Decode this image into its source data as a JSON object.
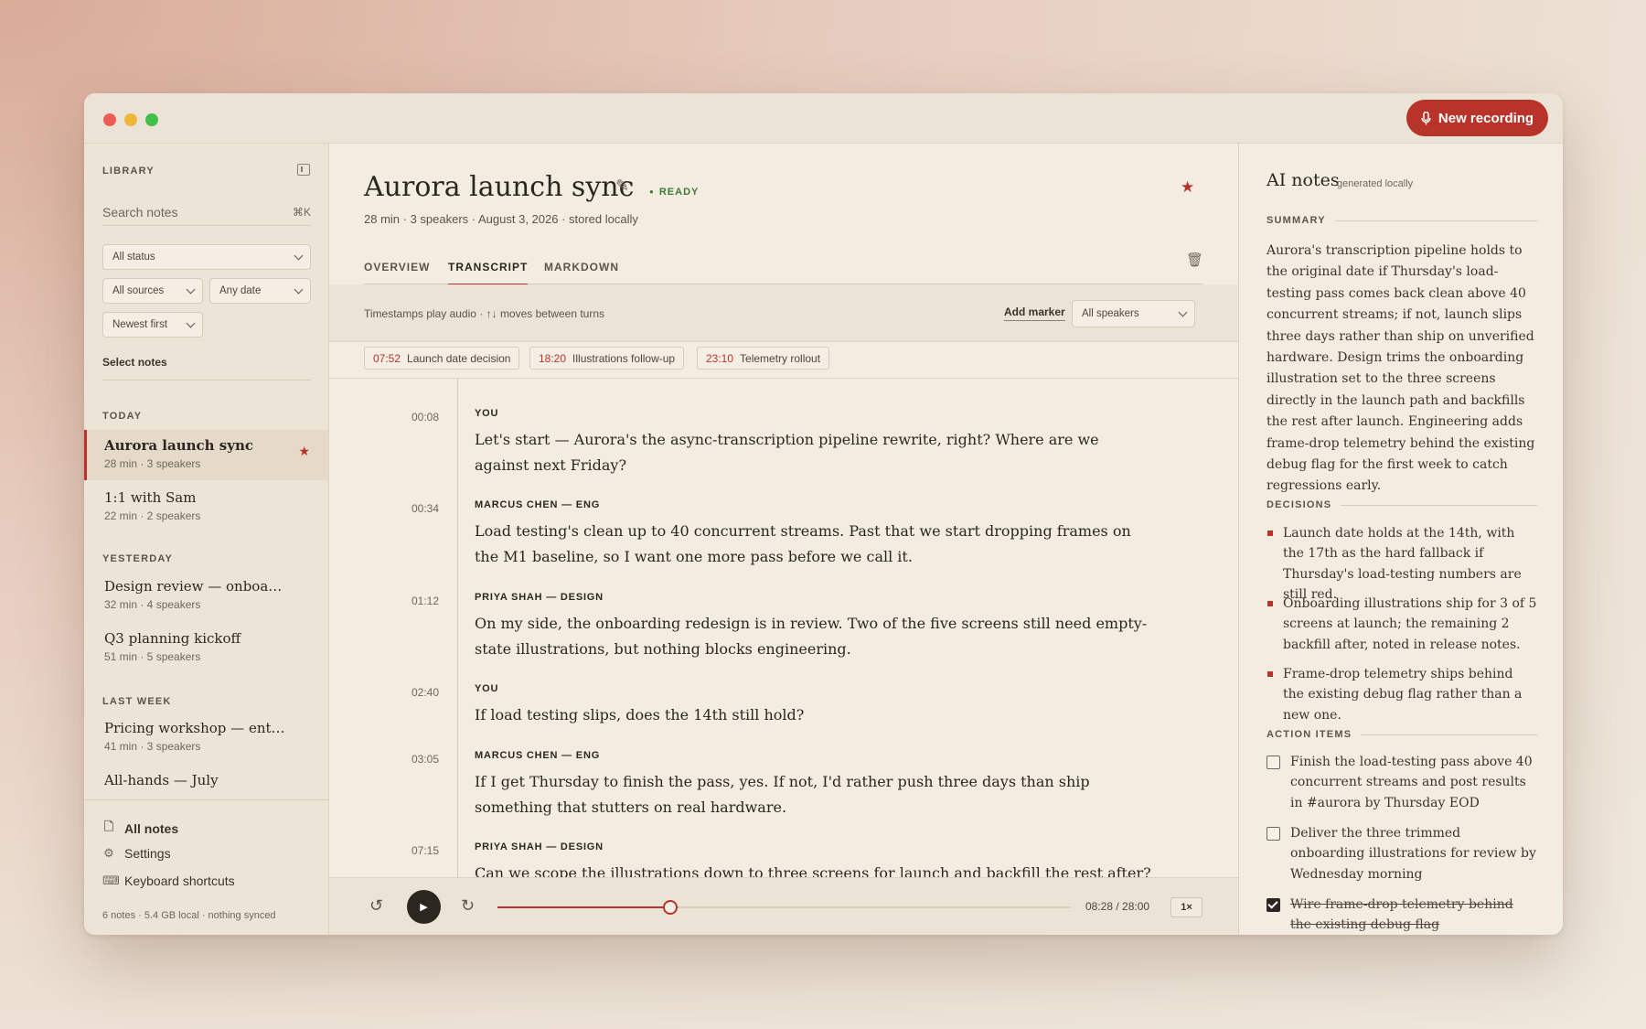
{
  "header": {
    "new_recording": "New recording",
    "mic_icon": "mic-icon"
  },
  "sidebar": {
    "library_label": "LIBRARY",
    "search_placeholder": "Search notes",
    "search_shortcut": "⌘K",
    "filters": {
      "status": "All status",
      "sources": "All sources",
      "date": "Any date",
      "sort": "Newest first"
    },
    "select_notes": "Select notes",
    "sections": [
      {
        "label": "TODAY",
        "notes": [
          {
            "title": "Aurora launch sync",
            "meta": "28 min · 3 speakers",
            "starred": true,
            "active": true
          }
        ]
      },
      {
        "label": "",
        "notes": [
          {
            "title": "1:1 with Sam",
            "meta": "22 min · 2 speakers"
          }
        ]
      },
      {
        "label": "YESTERDAY",
        "notes": [
          {
            "title": "Design review — onboardi…",
            "meta": "32 min · 4 speakers"
          },
          {
            "title": "Q3 planning kickoff",
            "meta": "51 min · 5 speakers"
          }
        ]
      },
      {
        "label": "LAST WEEK",
        "notes": [
          {
            "title": "Pricing workshop — enter…",
            "meta": "41 min · 3 speakers"
          },
          {
            "title": "All-hands — July",
            "meta": ""
          }
        ]
      }
    ],
    "nav": {
      "all_notes": "All notes",
      "settings": "Settings",
      "shortcuts": "Keyboard shortcuts"
    },
    "footer": "6 notes · 5.4 GB local · nothing synced"
  },
  "main": {
    "title": "Aurora launch sync",
    "status": "READY",
    "meta": "28 min · 3 speakers · August 3, 2026 · stored locally",
    "tabs": [
      "OVERVIEW",
      "TRANSCRIPT",
      "MARKDOWN"
    ],
    "active_tab": "TRANSCRIPT",
    "hint": "Timestamps play audio · ↑↓ moves between turns",
    "add_marker": "Add marker",
    "speaker_filter": "All speakers",
    "markers": [
      {
        "time": "07:52",
        "label": "Launch date decision"
      },
      {
        "time": "18:20",
        "label": "Illustrations follow-up"
      },
      {
        "time": "23:10",
        "label": "Telemetry rollout"
      }
    ],
    "turns": [
      {
        "time": "00:08",
        "speaker": "YOU",
        "text": "Let's start — Aurora's the async-transcription pipeline rewrite, right? Where are we against next Friday?"
      },
      {
        "time": "00:34",
        "speaker": "MARCUS CHEN — ENG",
        "text": "Load testing's clean up to 40 concurrent streams. Past that we start dropping frames on the M1 baseline, so I want one more pass before we call it."
      },
      {
        "time": "01:12",
        "speaker": "PRIYA SHAH — DESIGN",
        "text": "On my side, the onboarding redesign is in review. Two of the five screens still need empty-state illustrations, but nothing blocks engineering."
      },
      {
        "time": "02:40",
        "speaker": "YOU",
        "text": "If load testing slips, does the 14th still hold?"
      },
      {
        "time": "03:05",
        "speaker": "MARCUS CHEN — ENG",
        "text": "If I get Thursday to finish the pass, yes. If not, I'd rather push three days than ship something that stutters on real hardware."
      },
      {
        "time": "07:15",
        "speaker": "PRIYA SHAH — DESIGN",
        "text": "Can we scope the illustrations down to three screens for launch and backfill the rest after? That"
      }
    ],
    "player": {
      "current": "08:28",
      "total": "28:00",
      "time_display": "08:28 / 28:00",
      "progress": 0.302,
      "speed": "1×"
    }
  },
  "ai_notes": {
    "title": "AI notes",
    "subtitle": "generated locally",
    "summary_label": "SUMMARY",
    "summary": "Aurora's transcription pipeline holds to the original date if Thursday's load-testing pass comes back clean above 40 concurrent streams; if not, launch slips three days rather than ship on unverified hardware. Design trims the onboarding illustration set to the three screens directly in the launch path and backfills the rest after launch. Engineering adds frame-drop telemetry behind the existing debug flag for the first week to catch regressions early.",
    "decisions_label": "DECISIONS",
    "decisions": [
      "Launch date holds at the 14th, with the 17th as the hard fallback if Thursday's load-testing numbers are still red.",
      "Onboarding illustrations ship for 3 of 5 screens at launch; the remaining 2 backfill after, noted in release notes.",
      "Frame-drop telemetry ships behind the existing debug flag rather than a new one."
    ],
    "actions_label": "ACTION ITEMS",
    "actions": [
      {
        "text": "Finish the load-testing pass above 40 concurrent streams and post results in #aurora by Thursday EOD",
        "done": false
      },
      {
        "text": "Deliver the three trimmed onboarding illustrations for review by Wednesday morning",
        "done": false
      },
      {
        "text": "Wire frame-drop telemetry behind the existing debug flag",
        "done": true
      }
    ]
  },
  "colors": {
    "accent": "#b8342a",
    "ready": "#3f7a3a",
    "background": "#f2ece1"
  }
}
